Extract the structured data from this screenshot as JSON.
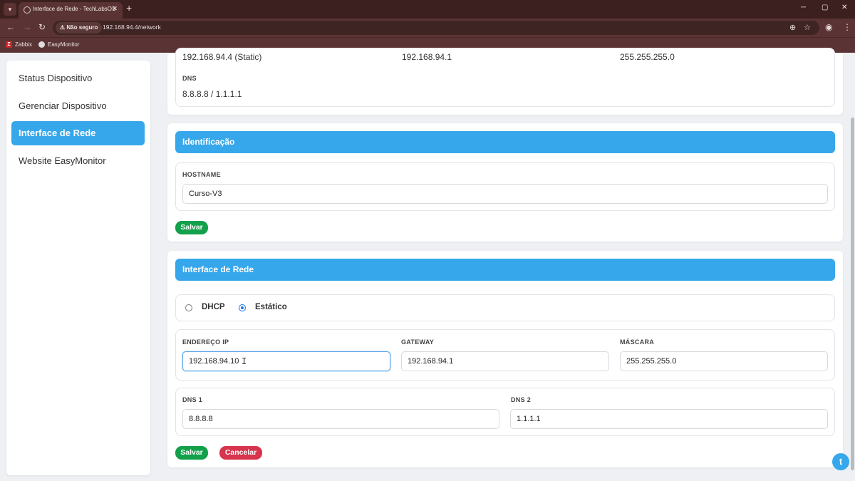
{
  "browser": {
    "tab_title": "Interface de Rede - TechLabsOS",
    "security_label": "Não seguro",
    "url": "192.168.94.4/network",
    "bookmarks": [
      {
        "label": "Zabbix",
        "icon": "zabbix-icon"
      },
      {
        "label": "EasyMonitor",
        "icon": "globe-icon"
      }
    ]
  },
  "sidebar": {
    "items": [
      {
        "label": "Status Dispositivo",
        "active": false
      },
      {
        "label": "Gerenciar Dispositivo",
        "active": false
      },
      {
        "label": "Interface de Rede",
        "active": true
      },
      {
        "label": "Website EasyMonitor",
        "active": false
      }
    ]
  },
  "current_config": {
    "ip": "192.168.94.4 (Static)",
    "gateway": "192.168.94.1",
    "mask": "255.255.255.0",
    "dns_label": "DNS",
    "dns": "8.8.8.8 / 1.1.1.1"
  },
  "identification": {
    "title": "Identificação",
    "hostname_label": "HOSTNAME",
    "hostname_value": "Curso-V3",
    "save_label": "Salvar"
  },
  "network_interface": {
    "title": "Interface de Rede",
    "mode_dhcp": "DHCP",
    "mode_static": "Estático",
    "selected_mode": "static",
    "ip_label": "ENDEREÇO IP",
    "ip_value": "192.168.94.10",
    "gateway_label": "GATEWAY",
    "gateway_value": "192.168.94.1",
    "mask_label": "MÁSCARA",
    "mask_value": "255.255.255.0",
    "dns1_label": "DNS 1",
    "dns1_value": "8.8.8.8",
    "dns2_label": "DNS 2",
    "dns2_value": "1.1.1.1",
    "save_label": "Salvar",
    "cancel_label": "Cancelar"
  },
  "colors": {
    "accent": "#36a7eb",
    "save": "#12a04a",
    "cancel": "#d8344d"
  }
}
